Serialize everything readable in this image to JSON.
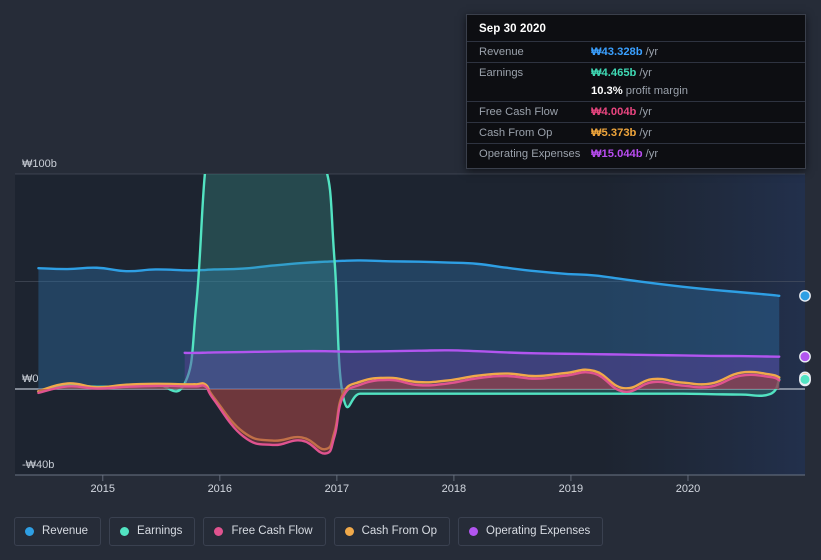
{
  "chart_data": {
    "type": "area",
    "title": "",
    "xlabel": "",
    "ylabel": "",
    "currency_symbol": "₩",
    "unit_suffix": "b",
    "ylim": [
      -40,
      100
    ],
    "xlim": [
      2014.25,
      2021.0
    ],
    "grid": true,
    "legend_position": "bottom",
    "y_ticks": [
      {
        "value": 100,
        "label": "₩100b"
      },
      {
        "value": 50,
        "label": ""
      },
      {
        "value": 0,
        "label": "₩0"
      },
      {
        "value": -40,
        "label": "-₩40b"
      }
    ],
    "x_ticks": [
      {
        "value": 2015,
        "label": "2015"
      },
      {
        "value": 2016,
        "label": "2016"
      },
      {
        "value": 2017,
        "label": "2017"
      },
      {
        "value": 2018,
        "label": "2018"
      },
      {
        "value": 2019,
        "label": "2019"
      },
      {
        "value": 2020,
        "label": "2020"
      }
    ],
    "x": [
      2014.45,
      2014.7,
      2014.95,
      2015.2,
      2015.45,
      2015.7,
      2015.8,
      2015.88,
      2015.95,
      2016.2,
      2016.45,
      2016.7,
      2016.9,
      2016.98,
      2017.05,
      2017.2,
      2017.45,
      2017.7,
      2017.95,
      2018.2,
      2018.45,
      2018.7,
      2018.95,
      2019.2,
      2019.45,
      2019.7,
      2019.95,
      2020.2,
      2020.45,
      2020.7,
      2020.78
    ],
    "series": [
      {
        "name": "Revenue",
        "color": "#2e9fe4",
        "fill": "rgba(45,112,170,0.40)",
        "values": [
          56.2,
          55.8,
          56.4,
          54.8,
          55.6,
          55.2,
          55.2,
          55.4,
          55.6,
          56.0,
          57.4,
          58.6,
          59.2,
          59.4,
          59.6,
          59.8,
          59.4,
          59.2,
          58.8,
          58.2,
          56.4,
          54.8,
          53.6,
          52.8,
          51.0,
          49.2,
          47.6,
          46.2,
          45.0,
          43.8,
          43.328
        ]
      },
      {
        "name": "Earnings",
        "color": "#52e3c2",
        "fill": "rgba(60,160,150,0.30)",
        "values": [
          -1.2,
          1.6,
          1.0,
          1.4,
          2.2,
          2.6,
          40.0,
          104.0,
          105.2,
          104.4,
          104.0,
          103.6,
          103.2,
          60.0,
          -2.4,
          -2.2,
          -2.2,
          -2.2,
          -2.2,
          -2.2,
          -2.2,
          -2.2,
          -2.2,
          -2.2,
          -2.2,
          -2.2,
          -2.2,
          -2.4,
          -2.6,
          -2.4,
          4.465
        ]
      },
      {
        "name": "Free Cash Flow",
        "color": "#e0538f",
        "fill": "rgba(150,60,70,0.52)",
        "values": [
          -1.8,
          1.2,
          0.2,
          1.0,
          1.4,
          1.2,
          1.2,
          1.0,
          -5.0,
          -22.0,
          -26.0,
          -24.0,
          -30.0,
          -22.0,
          -4.0,
          2.0,
          4.2,
          1.8,
          2.6,
          5.0,
          6.0,
          4.8,
          6.2,
          7.2,
          -1.2,
          3.2,
          1.6,
          1.2,
          6.2,
          5.6,
          4.004
        ]
      },
      {
        "name": "Cash From Op",
        "color": "#f0a94a",
        "fill": "rgba(160,90,50,0.30)",
        "values": [
          -1.0,
          2.6,
          0.8,
          2.0,
          2.4,
          2.2,
          2.2,
          2.0,
          -4.0,
          -20.0,
          -24.0,
          -22.5,
          -28.0,
          -20.0,
          -2.5,
          3.4,
          5.2,
          3.2,
          4.0,
          6.2,
          7.2,
          6.0,
          7.4,
          8.4,
          0.4,
          4.6,
          3.0,
          2.6,
          7.6,
          6.8,
          5.373
        ]
      },
      {
        "name": "Operating Expenses",
        "color": "#b255f0",
        "fill": "rgba(95,65,160,0.45)",
        "values": [
          null,
          null,
          null,
          null,
          null,
          16.8,
          16.8,
          16.9,
          17.0,
          17.2,
          17.4,
          17.6,
          17.6,
          17.5,
          17.4,
          17.4,
          17.6,
          17.8,
          18.0,
          17.6,
          17.0,
          16.6,
          16.4,
          16.2,
          16.0,
          15.8,
          15.6,
          15.4,
          15.3,
          15.1,
          15.044
        ]
      }
    ],
    "end_markers": [
      {
        "name": "Revenue",
        "value": 43.328,
        "color": "#2e9fe4"
      },
      {
        "name": "Operating Expenses",
        "value": 15.044,
        "color": "#b255f0"
      },
      {
        "name": "Cash From Op",
        "value": 5.373,
        "color": "#f0a94a"
      },
      {
        "name": "Free Cash Flow",
        "value": 4.004,
        "color": "#e0538f"
      },
      {
        "name": "Earnings",
        "value": 4.465,
        "color": "#52e3c2"
      }
    ]
  },
  "tooltip": {
    "date": "Sep 30 2020",
    "rows": [
      {
        "label": "Revenue",
        "value": "₩43.328b",
        "unit": "/yr",
        "color": "#3aa0ff"
      },
      {
        "label": "Earnings",
        "value": "₩4.465b",
        "unit": "/yr",
        "color": "#3fd9b4"
      },
      {
        "label": "",
        "value": "10.3%",
        "unit": "profit margin",
        "color": "#ffffff",
        "sub": true
      },
      {
        "label": "Free Cash Flow",
        "value": "₩4.004b",
        "unit": "/yr",
        "color": "#e8457f"
      },
      {
        "label": "Cash From Op",
        "value": "₩5.373b",
        "unit": "/yr",
        "color": "#f0a63c"
      },
      {
        "label": "Operating Expenses",
        "value": "₩15.044b",
        "unit": "/yr",
        "color": "#b84cf0"
      }
    ]
  },
  "legend": {
    "items": [
      {
        "label": "Revenue",
        "color": "#2e9fe4"
      },
      {
        "label": "Earnings",
        "color": "#52e3c2"
      },
      {
        "label": "Free Cash Flow",
        "color": "#e0538f"
      },
      {
        "label": "Cash From Op",
        "color": "#f0a94a"
      },
      {
        "label": "Operating Expenses",
        "color": "#b255f0"
      }
    ]
  }
}
